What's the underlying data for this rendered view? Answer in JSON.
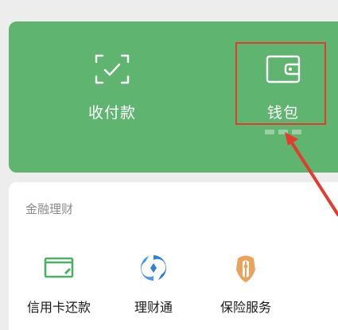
{
  "pay_card": {
    "items": [
      {
        "label": "收付款",
        "icon": "scan-check-icon"
      },
      {
        "label": "钱包",
        "icon": "wallet-icon"
      }
    ]
  },
  "finance": {
    "title": "金融理财",
    "items": [
      {
        "label": "信用卡还款",
        "icon": "credit-card-icon"
      },
      {
        "label": "理财通",
        "icon": "licaitong-icon"
      },
      {
        "label": "保险服务",
        "icon": "insurance-icon"
      }
    ]
  },
  "colors": {
    "green": "#5fb46f",
    "highlight": "#e33b2e",
    "text_secondary": "#8a8a8a"
  }
}
